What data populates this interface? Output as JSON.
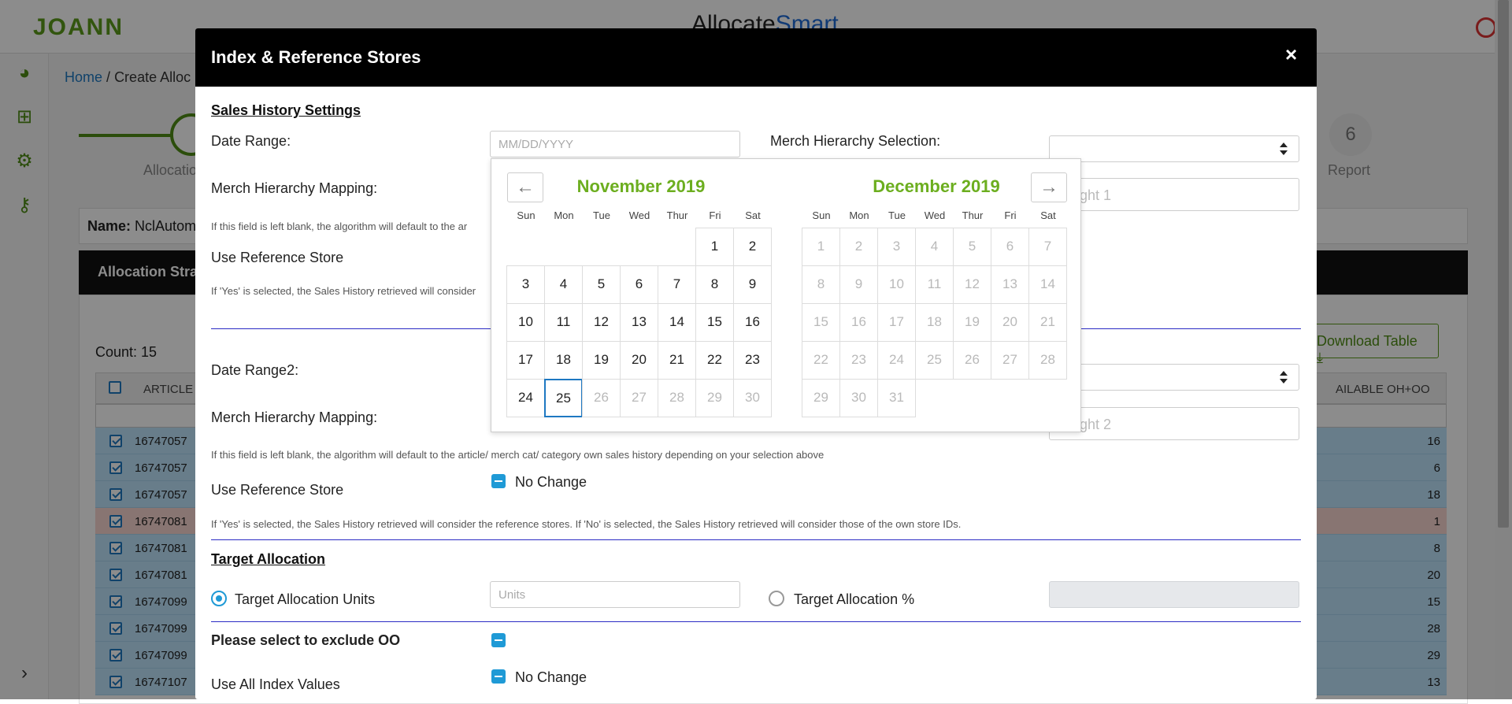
{
  "app": {
    "brand": "JOANN",
    "title_part1": "Allocate",
    "title_part2": "Smart"
  },
  "breadcrumb": {
    "home": "Home",
    "separator": "/",
    "current": "Create Alloc"
  },
  "stepper": {
    "step1_label": "Allocatio",
    "step6_number": "6",
    "step6_label": "Report"
  },
  "name_row": {
    "label": "Name:",
    "value": "NclAutom"
  },
  "strategy_header": "Allocation Stra",
  "table": {
    "count": "Count: 15",
    "download_label": "Download Table",
    "col_article": "ARTICLE",
    "col_oh_oo": "AILABLE OH+OO",
    "rows": [
      {
        "article": "16747057",
        "value": "16"
      },
      {
        "article": "16747057",
        "value": "6"
      },
      {
        "article": "16747057",
        "value": "18"
      },
      {
        "article": "16747081",
        "value": "1"
      },
      {
        "article": "16747081",
        "value": "8"
      },
      {
        "article": "16747081",
        "value": "20"
      },
      {
        "article": "16747099",
        "value": "15"
      },
      {
        "article": "16747099",
        "value": "28"
      },
      {
        "article": "16747099",
        "value": "29"
      },
      {
        "article": "16747107",
        "value": "13"
      }
    ]
  },
  "modal": {
    "title": "Index & Reference Stores",
    "close": "×",
    "sales_history": {
      "title": "Sales History Settings",
      "date_range_label": "Date Range:",
      "date_range_placeholder": "MM/DD/YYYY",
      "merch_selection_label": "Merch Hierarchy Selection:",
      "merch_mapping_label": "Merch Hierarchy Mapping:",
      "weight1_placeholder": "ght 1",
      "blank_help_short": "If this field is left blank, the algorithm will default to the ar",
      "use_ref_label": "Use Reference Store",
      "yes_help_short": "If 'Yes' is selected, the Sales History retrieved will consider"
    },
    "sales_history2": {
      "date_range_label": "Date Range2:",
      "merch_mapping_label": "Merch Hierarchy Mapping:",
      "weight2_placeholder": "ght 2",
      "blank_help": "If this field is left blank, the algorithm will default to the article/ merch cat/ category own sales history depending on your selection above",
      "use_ref_label": "Use Reference Store",
      "no_change": "No Change",
      "yes_help": "If 'Yes' is selected, the Sales History retrieved will consider the reference stores. If 'No' is selected, the Sales History retrieved will consider those of the own store IDs."
    },
    "target": {
      "title": "Target Allocation",
      "units_label": "Target Allocation Units",
      "units_placeholder": "Units",
      "percent_label": "Target Allocation %"
    },
    "exclude_oo_label": "Please select to exclude OO",
    "index_values_label": "Use All Index Values",
    "index_values_no_change": "No Change"
  },
  "calendar": {
    "prev": "←",
    "next": "→",
    "dow": [
      "Sun",
      "Mon",
      "Tue",
      "Wed",
      "Thur",
      "Fri",
      "Sat"
    ],
    "left_month": {
      "title": "November 2019",
      "leading_blanks": 5,
      "days": 30,
      "today": 25
    },
    "right_month": {
      "title": "December 2019",
      "leading_blanks": 0,
      "days": 31,
      "today": null
    }
  },
  "colors": {
    "brand_green": "#5b9c1a",
    "calendar_green": "#6cae1f",
    "accent_blue": "#1f9ad6",
    "header_black": "#000000"
  }
}
